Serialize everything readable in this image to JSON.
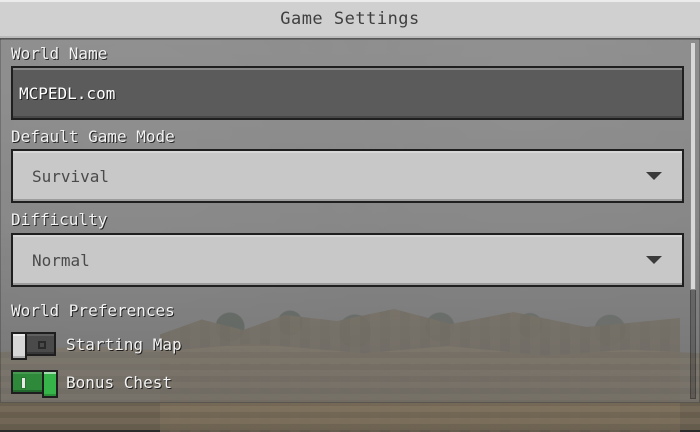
{
  "header": {
    "title": "Game Settings"
  },
  "settings": {
    "world_name": {
      "label": "World Name",
      "value": "MCPEDL.com"
    },
    "default_game_mode": {
      "label": "Default Game Mode",
      "value": "Survival"
    },
    "difficulty": {
      "label": "Difficulty",
      "value": "Normal"
    },
    "world_preferences": {
      "label": "World Preferences",
      "toggles": [
        {
          "label": "Starting Map",
          "state": "off"
        },
        {
          "label": "Bonus Chest",
          "state": "on"
        }
      ]
    }
  },
  "ui": {
    "colors": {
      "panel_dark": "#5b5b5b",
      "panel_light": "#c8c8c8",
      "toggle_on": "#37b449",
      "toggle_off": "#4a4a4a"
    },
    "icons": {
      "dropdown": "chevron-down-icon",
      "scroll": "scrollbar-icon"
    }
  }
}
